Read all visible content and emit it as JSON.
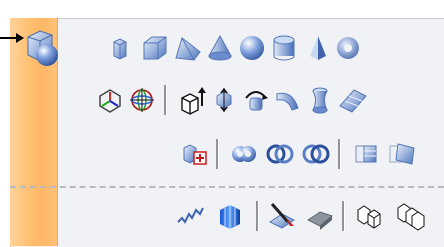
{
  "toolbar": {
    "category_tooltip": "",
    "rows": [
      {
        "items": [
          {
            "name": "box-icon"
          },
          {
            "name": "cube-icon"
          },
          {
            "name": "wedge-icon"
          },
          {
            "name": "cone-icon"
          },
          {
            "name": "sphere-icon"
          },
          {
            "name": "cylinder-icon"
          },
          {
            "name": "pyramid-icon"
          },
          {
            "name": "torus-icon"
          }
        ]
      },
      {
        "items": [
          {
            "name": "coordinate-system-icon"
          },
          {
            "name": "globe-axes-icon"
          },
          {
            "name": "separator"
          },
          {
            "name": "extrude-icon"
          },
          {
            "name": "move-along-icon"
          },
          {
            "name": "revolve-icon"
          },
          {
            "name": "sweep-icon"
          },
          {
            "name": "loft-icon"
          },
          {
            "name": "surface-icon"
          }
        ]
      },
      {
        "items": [
          {
            "name": "add-to-object-icon"
          },
          {
            "name": "separator"
          },
          {
            "name": "boolean-union-icon"
          },
          {
            "name": "boolean-intersection-icon"
          },
          {
            "name": "boolean-subtract-icon"
          },
          {
            "name": "separator"
          },
          {
            "name": "mesh-smooth-icon"
          },
          {
            "name": "mesh-transform-icon"
          }
        ]
      },
      {
        "items": [
          {
            "name": "noise-icon"
          },
          {
            "name": "bevel-icon"
          },
          {
            "name": "separator"
          },
          {
            "name": "slice-icon"
          },
          {
            "name": "eraser-icon"
          },
          {
            "name": "separator"
          },
          {
            "name": "copy-object-icon"
          },
          {
            "name": "array-object-icon"
          }
        ]
      }
    ]
  },
  "colors": {
    "panel_bg": "#f1f2f5",
    "tab_orange": "#ffc072",
    "icon_blue": "#5b7fc4",
    "icon_light": "#c9dbf3"
  }
}
